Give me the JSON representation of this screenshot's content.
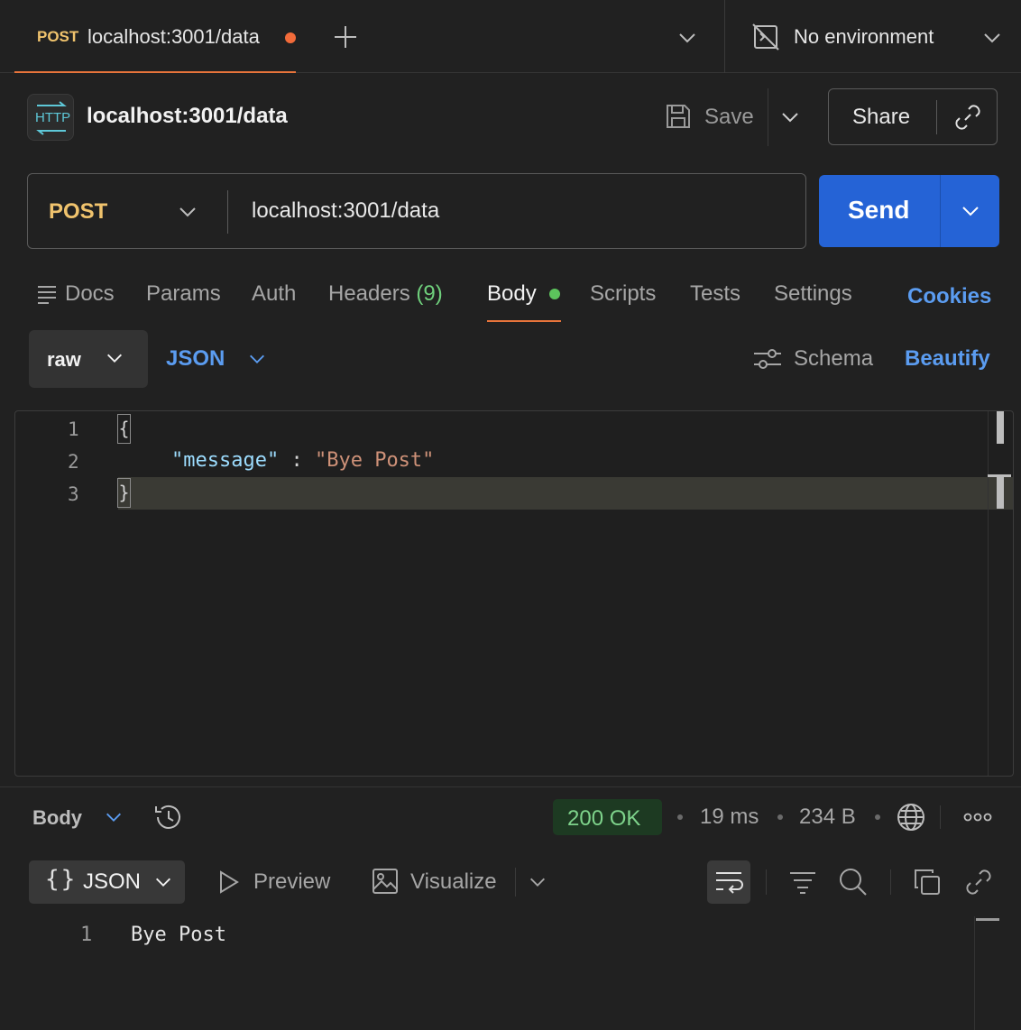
{
  "tabs": [
    {
      "method": "POST",
      "url": "localhost:3001/data",
      "unsaved": true
    }
  ],
  "environment": {
    "label": "No environment"
  },
  "request": {
    "title": "localhost:3001/data",
    "badge": "HTTP",
    "save_label": "Save",
    "share_label": "Share",
    "method": "POST",
    "url": "localhost:3001/data",
    "send_label": "Send"
  },
  "request_tabs": {
    "docs": "Docs",
    "params": "Params",
    "auth": "Auth",
    "headers": "Headers",
    "headers_count": "(9)",
    "body": "Body",
    "scripts": "Scripts",
    "tests": "Tests",
    "settings": "Settings",
    "cookies": "Cookies"
  },
  "body_toolbar": {
    "mode": "raw",
    "format": "JSON",
    "schema": "Schema",
    "beautify": "Beautify"
  },
  "editor": {
    "line_numbers": [
      "1",
      "2",
      "3"
    ],
    "open_brace": "{",
    "key": "\"message\"",
    "colon": " : ",
    "value": "\"Bye Post\"",
    "close_brace": "}"
  },
  "response": {
    "view": "Body",
    "status": "200 OK",
    "time": "19 ms",
    "size": "234 B",
    "format": "JSON",
    "preview": "Preview",
    "visualize": "Visualize",
    "line_number": "1",
    "text": "Bye Post"
  },
  "colors": {
    "accent_orange": "#e8743b",
    "method_yellow": "#f0c36d",
    "send_blue": "#2563d6",
    "link_blue": "#5b9cf0",
    "success_green": "#7ed38b"
  }
}
